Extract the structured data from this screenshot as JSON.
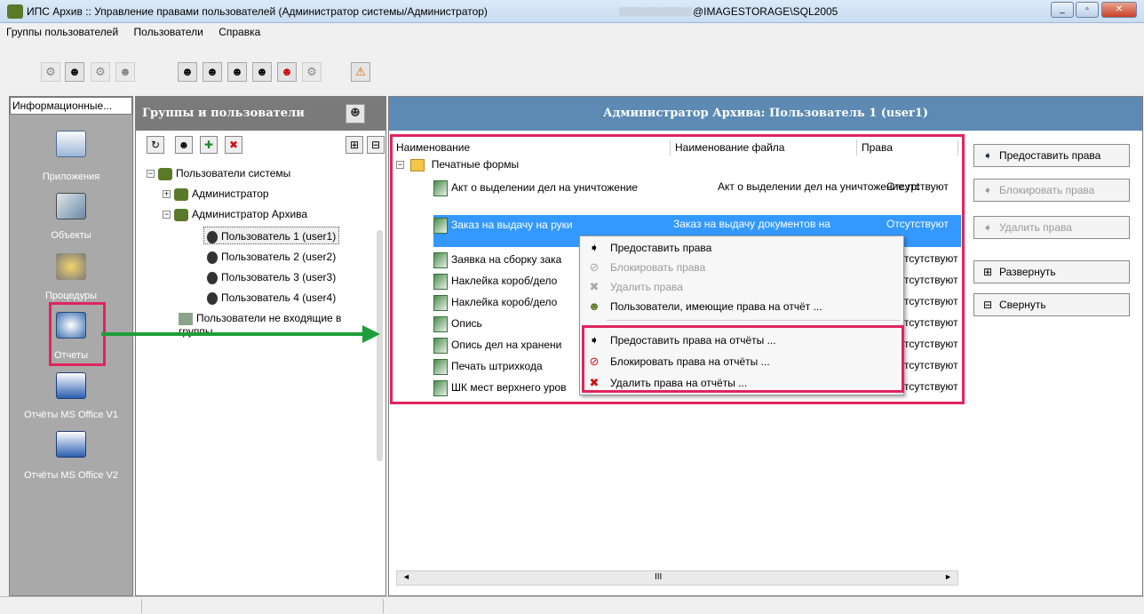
{
  "window": {
    "title": "ИПС Архив :: Управление правами пользователей (Администратор системы/Администратор)",
    "title_server": "@IMAGESTORAGE\\SQL2005",
    "controls": [
      "_",
      "▫",
      "✕"
    ]
  },
  "menu": [
    "Группы пользователей",
    "Пользователи",
    "Справка"
  ],
  "left_panel": {
    "header": "Информационные...",
    "items": [
      {
        "label": "Приложения",
        "icon": "applications-icon"
      },
      {
        "label": "Объекты",
        "icon": "objects-icon"
      },
      {
        "label": "Процедуры",
        "icon": "procedures-icon"
      },
      {
        "label": "Отчеты",
        "icon": "reports-icon",
        "selected": true
      },
      {
        "label": "Отчёты MS Office V1",
        "icon": "word-icon"
      },
      {
        "label": "Отчёты MS Office V2",
        "icon": "word-icon"
      }
    ]
  },
  "groups_panel": {
    "header": "Группы и пользователи",
    "tree": [
      {
        "label": "Пользователи системы",
        "level": 0,
        "expand": "−"
      },
      {
        "label": "Администратор",
        "level": 1,
        "expand": "+"
      },
      {
        "label": "Администратор Архива",
        "level": 1,
        "expand": "−"
      },
      {
        "label": "Пользователь 1 (user1)",
        "level": 2,
        "selected": true
      },
      {
        "label": "Пользователь 2 (user2)",
        "level": 2
      },
      {
        "label": "Пользователь 3 (user3)",
        "level": 2
      },
      {
        "label": "Пользователь 4 (user4)",
        "level": 2
      },
      {
        "label": "Пользователи не входящие в группы",
        "level": 1
      }
    ]
  },
  "rights_panel": {
    "header": "Администратор Архива: Пользователь 1 (user1)",
    "columns": [
      "Наименование",
      "Наименование файла",
      "Права"
    ],
    "folder": "Печатные формы",
    "rows": [
      {
        "name": "Акт о выделении дел на уничтожение",
        "file": "Акт о выделении дел на уничтожение.rpt",
        "rights": "Отсутствуют"
      },
      {
        "name": "Заказ на выдачу на руки",
        "file": "Заказ на выдачу документов на",
        "rights": "Отсутствуют",
        "selected": true
      },
      {
        "name": "Заявка на сборку зака",
        "file": "",
        "rights": "тсутствуют"
      },
      {
        "name": "Наклейка короб/дело",
        "file": "",
        "rights": "тсутствуют"
      },
      {
        "name": "Наклейка короб/дело",
        "file": "",
        "rights": "тсутствуют"
      },
      {
        "name": "Опись",
        "file": "",
        "rights": "тсутствуют"
      },
      {
        "name": "Опись дел на хранени",
        "file": "",
        "rights": "тсутствуют"
      },
      {
        "name": "Печать штрихкода",
        "file": "",
        "rights": "тсутствуют"
      },
      {
        "name": "ШК мест верхнего уров",
        "file": "",
        "rights": "тсутствуют"
      }
    ],
    "scroll_glyph": "III"
  },
  "actions": [
    {
      "label": "Предоставить права",
      "enabled": true
    },
    {
      "label": "Блокировать права",
      "enabled": false
    },
    {
      "label": "Удалить права",
      "enabled": false
    },
    {
      "label": "Развернуть",
      "enabled": true
    },
    {
      "label": "Свернуть",
      "enabled": true
    }
  ],
  "context_menu": [
    {
      "label": "Предоставить права",
      "enabled": true
    },
    {
      "label": "Блокировать права",
      "enabled": false
    },
    {
      "label": "Удалить права",
      "enabled": false
    },
    {
      "label": "Пользователи, имеющие права на отчёт ...",
      "enabled": true
    },
    {
      "label": "Предоставить права на отчёты ...",
      "enabled": true
    },
    {
      "label": "Блокировать права на отчёты ...",
      "enabled": true
    },
    {
      "label": "Удалить права на отчёты ...",
      "enabled": true
    }
  ],
  "colors": {
    "highlight": "#e0245e",
    "selection": "#3399ff",
    "arrow": "#1e9e3a",
    "header_blue": "#5c8ab3"
  }
}
